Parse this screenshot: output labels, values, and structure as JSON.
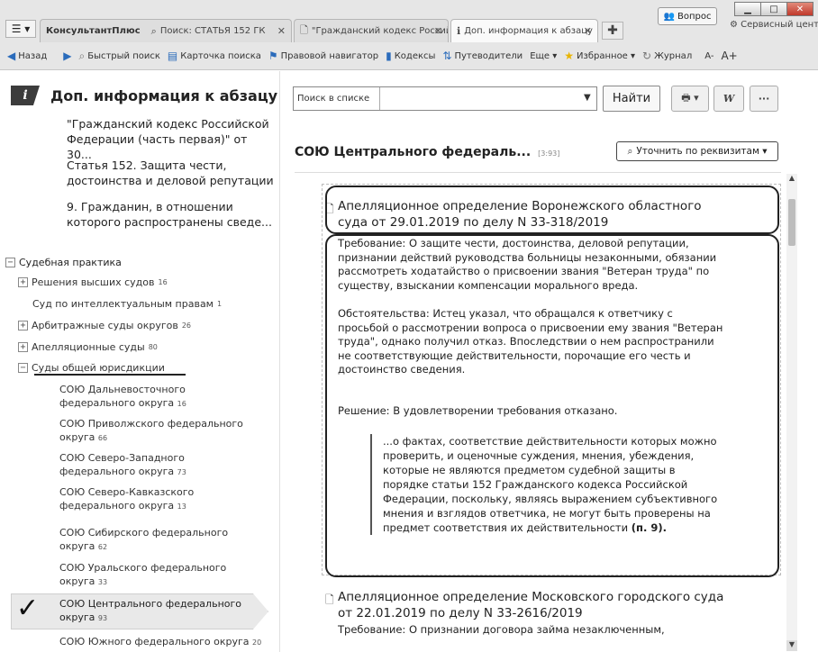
{
  "tabs": [
    {
      "label": "КонсультантПлюс"
    },
    {
      "label": "Поиск: СТАТЬЯ 152 ГК"
    },
    {
      "label": "\"Гражданский кодекс Россий"
    },
    {
      "label": "Доп. информация к абзацу"
    }
  ],
  "window": {
    "question_label": "Вопрос",
    "service_center": "Сервисный центр"
  },
  "navbar": {
    "back": "Назад",
    "quick_search": "Быстрый поиск",
    "search_card": "Карточка поиска",
    "legal_navigator": "Правовой навигатор",
    "codes": "Кодексы",
    "guides": "Путеводители",
    "more": "Еще ▾",
    "favorites": "Избранное ▾",
    "journal": "Журнал",
    "font_smaller": "A-",
    "font_larger": "A+"
  },
  "left": {
    "title": "Доп. информация к абзацу",
    "context": [
      "\"Гражданский кодекс Российской Федерации (часть первая)\" от 30...",
      "Статья 152. Защита чести, достоинства и деловой репутации",
      "9. Гражданин, в отношении которого распространены сведе..."
    ],
    "tree_root": "Судебная практика",
    "tree": [
      {
        "label": "Решения высших судов",
        "count": "16",
        "pm": "+"
      },
      {
        "label": "Суд по интеллектуальным правам",
        "count": "1",
        "pm": ""
      },
      {
        "label": "Арбитражные суды округов",
        "count": "26",
        "pm": "+"
      },
      {
        "label": "Апелляционные суды",
        "count": "80",
        "pm": "+"
      },
      {
        "label": "Суды общей юрисдикции",
        "count": "",
        "pm": "−"
      }
    ],
    "courts": [
      {
        "label": "СОЮ Дальневосточного федерального округа",
        "count": "16"
      },
      {
        "label": "СОЮ Приволжского федерального округа",
        "count": "66"
      },
      {
        "label": "СОЮ Северо-Западного федерального округа",
        "count": "73"
      },
      {
        "label": "СОЮ Северо-Кавказского федерального округа",
        "count": "13"
      },
      {
        "label": "СОЮ Сибирского федерального округа",
        "count": "62"
      },
      {
        "label": "СОЮ Уральского федерального округа",
        "count": "33"
      },
      {
        "label": "СОЮ Центрального федерального округа",
        "count": "93"
      },
      {
        "label": "СОЮ Южного федерального округа",
        "count": "20"
      }
    ]
  },
  "right": {
    "search_label": "Поиск в списке",
    "search_value": "",
    "find_button": "Найти",
    "doc_title": "СОЮ Центрального федераль...",
    "doc_range": "[3:93]",
    "refine_button": "Уточнить по реквизитам ▾",
    "case1_title": "Апелляционное определение Воронежского областного суда от 29.01.2019 по делу N 33-318/2019",
    "case1_body": [
      "Требование: О защите чести, достоинства, деловой репутации, признании действий руководства больницы незаконными, обязании рассмотреть ходатайство о присвоении звания \"Ветеран труда\" по существу, взыскании компенсации морального вреда.",
      "Обстоятельства: Истец указал, что обращался к ответчику с просьбой о рассмотрении вопроса о присвоении ему звания \"Ветеран труда\", однако получил отказ. Впоследствии о нем распространили не соответствующие действительности, порочащие его честь и достоинство сведения.",
      "Решение: В удовлетворении требования отказано."
    ],
    "case1_quote": "...о фактах, соответствие действительности которых можно проверить, и оценочные суждения, мнения, убеждения, которые не являются предметом судебной защиты в порядке статьи 152 Гражданского кодекса Российской Федерации, поскольку, являясь выражением субъективного мнения и взглядов ответчика, не могут быть проверены на предмет соответствия их действительности",
    "case1_quote_ref": "(п. 9).",
    "case2_title": "Апелляционное определение Московского городского суда от 22.01.2019 по делу N 33-2616/2019",
    "case2_body": "Требование: О признании договора займа незаключенным,"
  }
}
